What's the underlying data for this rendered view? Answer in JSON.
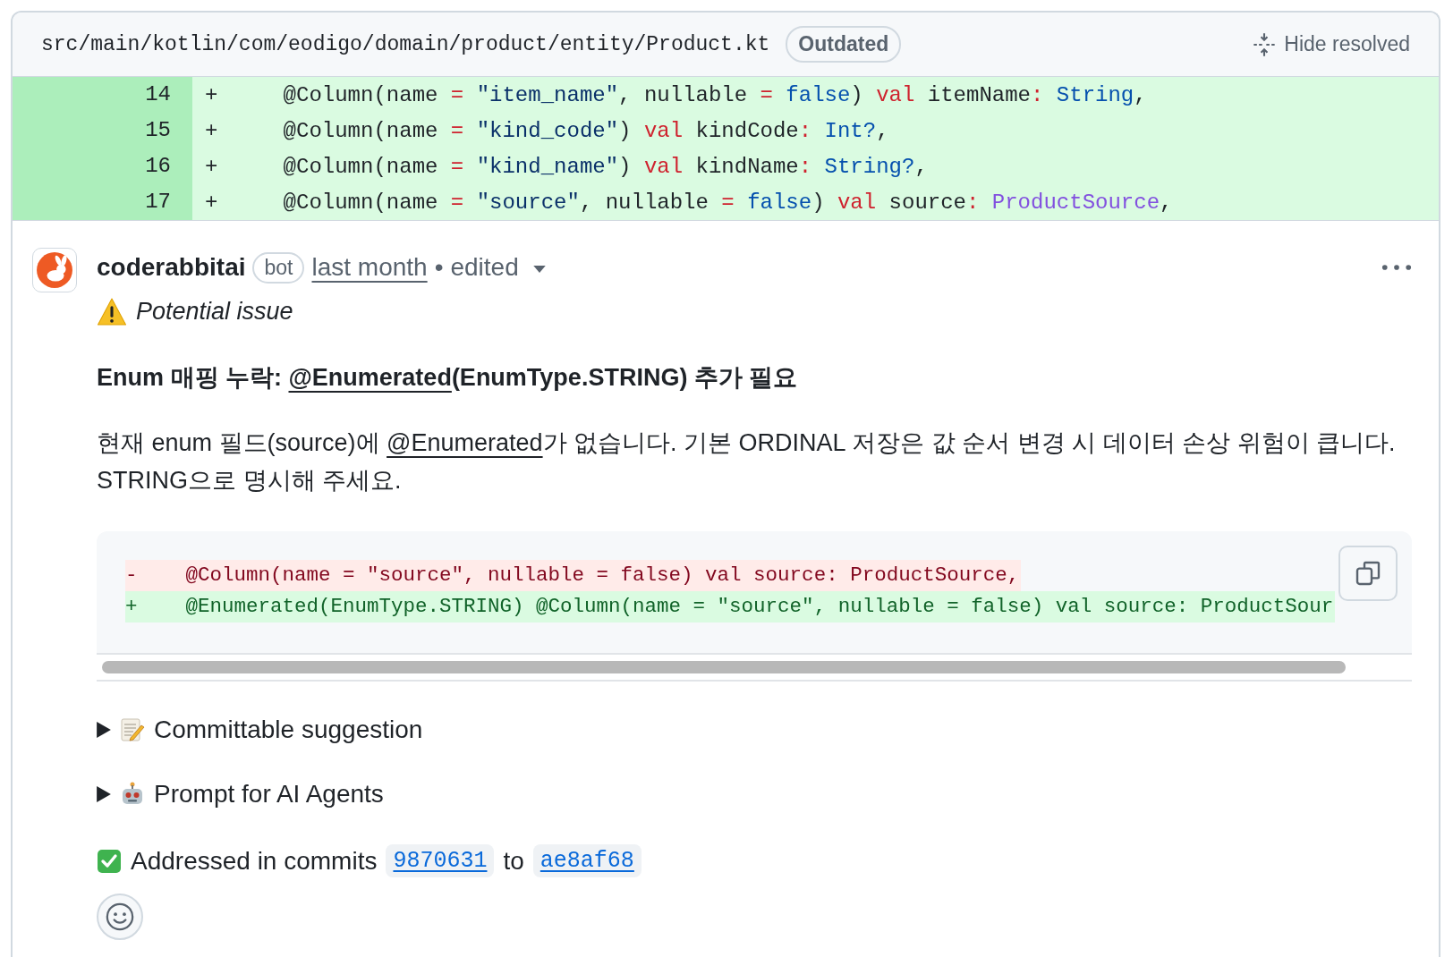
{
  "file_header": {
    "path": "src/main/kotlin/com/eodigo/domain/product/entity/Product.kt",
    "badge": "Outdated",
    "hide_button": "Hide resolved"
  },
  "diff_lines": [
    {
      "number": "14",
      "sign": "+",
      "tokens": [
        {
          "text": "    @Column(name ",
          "kind": "plain"
        },
        {
          "text": "= ",
          "kind": "keyword"
        },
        {
          "text": "\"item_name\"",
          "kind": "string"
        },
        {
          "text": ", nullable ",
          "kind": "plain"
        },
        {
          "text": "= ",
          "kind": "keyword"
        },
        {
          "text": "false",
          "kind": "constant"
        },
        {
          "text": ") ",
          "kind": "plain"
        },
        {
          "text": "val",
          "kind": "keyword"
        },
        {
          "text": " itemName",
          "kind": "plain"
        },
        {
          "text": ": ",
          "kind": "keyword"
        },
        {
          "text": "String",
          "kind": "constant"
        },
        {
          "text": ",",
          "kind": "plain"
        }
      ]
    },
    {
      "number": "15",
      "sign": "+",
      "tokens": [
        {
          "text": "    @Column(name ",
          "kind": "plain"
        },
        {
          "text": "= ",
          "kind": "keyword"
        },
        {
          "text": "\"kind_code\"",
          "kind": "string"
        },
        {
          "text": ") ",
          "kind": "plain"
        },
        {
          "text": "val",
          "kind": "keyword"
        },
        {
          "text": " kindCode",
          "kind": "plain"
        },
        {
          "text": ": ",
          "kind": "keyword"
        },
        {
          "text": "Int?",
          "kind": "constant"
        },
        {
          "text": ",",
          "kind": "plain"
        }
      ]
    },
    {
      "number": "16",
      "sign": "+",
      "tokens": [
        {
          "text": "    @Column(name ",
          "kind": "plain"
        },
        {
          "text": "= ",
          "kind": "keyword"
        },
        {
          "text": "\"kind_name\"",
          "kind": "string"
        },
        {
          "text": ") ",
          "kind": "plain"
        },
        {
          "text": "val",
          "kind": "keyword"
        },
        {
          "text": " kindName",
          "kind": "plain"
        },
        {
          "text": ": ",
          "kind": "keyword"
        },
        {
          "text": "String?",
          "kind": "constant"
        },
        {
          "text": ",",
          "kind": "plain"
        }
      ]
    },
    {
      "number": "17",
      "sign": "+",
      "tokens": [
        {
          "text": "    @Column(name ",
          "kind": "plain"
        },
        {
          "text": "= ",
          "kind": "keyword"
        },
        {
          "text": "\"source\"",
          "kind": "string"
        },
        {
          "text": ", nullable ",
          "kind": "plain"
        },
        {
          "text": "= ",
          "kind": "keyword"
        },
        {
          "text": "false",
          "kind": "constant"
        },
        {
          "text": ") ",
          "kind": "plain"
        },
        {
          "text": "val",
          "kind": "keyword"
        },
        {
          "text": " source",
          "kind": "plain"
        },
        {
          "text": ": ",
          "kind": "keyword"
        },
        {
          "text": "ProductSource",
          "kind": "class"
        },
        {
          "text": ",",
          "kind": "plain"
        }
      ]
    }
  ],
  "comment": {
    "author": "coderabbitai",
    "author_badge": "bot",
    "time": "last month",
    "separator": "•",
    "edited": "edited",
    "label": "Potential issue",
    "title": {
      "before": "Enum 매핑 누락: ",
      "link": "@Enumerated",
      "after": "(EnumType.STRING) 추가 필요"
    },
    "paragraph": {
      "before": "현재 enum 필드(source)에 ",
      "link": "@Enumerated",
      "after": "가 없습니다. 기본 ORDINAL 저장은 값 순서 변경 시 데이터 손상 위험이 큽니다. STRING으로 명시해 주세요."
    },
    "suggestion": [
      {
        "kind": "removed",
        "code": "-    @Column(name = \"source\", nullable = false) val source: ProductSource,"
      },
      {
        "kind": "added",
        "code": "+    @Enumerated(EnumType.STRING) @Column(name = \"source\", nullable = false) val source: ProductSour"
      }
    ],
    "details": [
      {
        "kind": "memo",
        "label": "Committable suggestion",
        "expanded": false
      },
      {
        "kind": "robot",
        "label": "Prompt for AI Agents",
        "expanded": false
      }
    ],
    "addressed": {
      "text": "Addressed in commits",
      "from": "9870631",
      "joiner": "to",
      "to": "ae8af68"
    }
  }
}
